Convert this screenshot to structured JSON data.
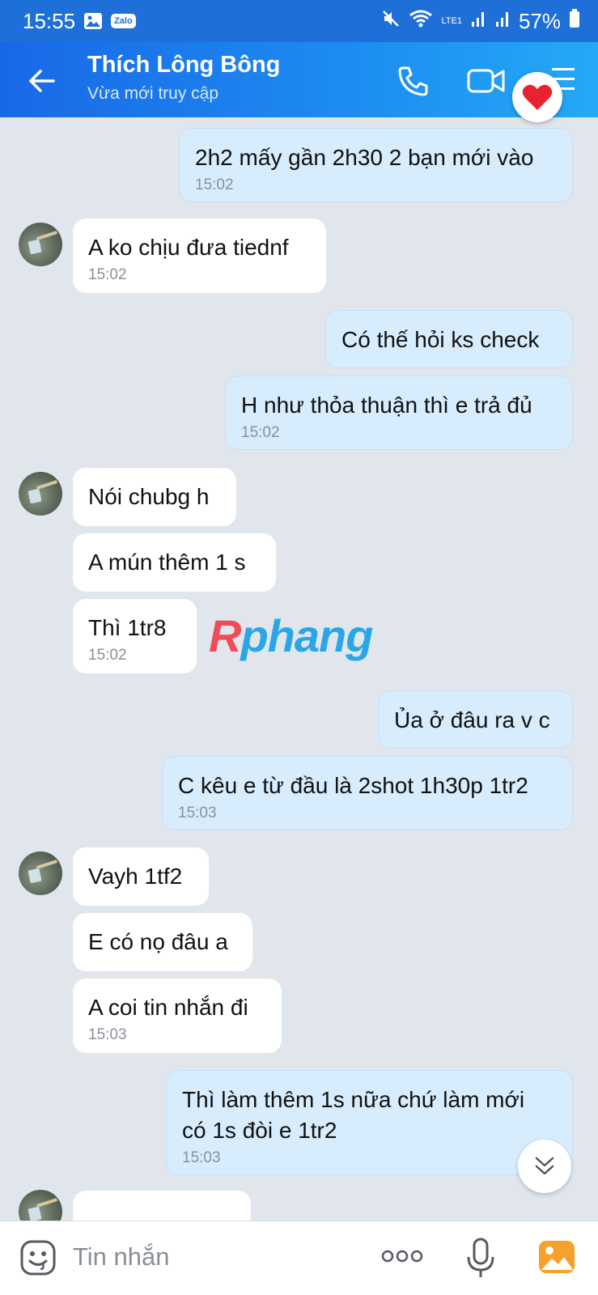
{
  "status_bar": {
    "time": "15:55",
    "battery": "57%",
    "network": "LTE1"
  },
  "header": {
    "title": "Thích Lông Bông",
    "subtitle": "Vừa mới truy cập"
  },
  "messages": [
    {
      "dir": "out",
      "text": "2h2 mấy gần 2h30 2 bạn mới vào",
      "time": "15:02"
    },
    {
      "dir": "in",
      "text": "A ko chịu đưa tiednf",
      "time": "15:02"
    },
    {
      "dir": "out",
      "text": "Có thế hỏi ks check",
      "time": ""
    },
    {
      "dir": "out",
      "text": "H như thỏa thuận thì e trả đủ",
      "time": "15:02"
    },
    {
      "dir": "in",
      "text": "Nói chubg h",
      "time": ""
    },
    {
      "dir": "in",
      "text": "A mún thêm 1 s",
      "time": ""
    },
    {
      "dir": "in",
      "text": "Thì 1tr8",
      "time": "15:02"
    },
    {
      "dir": "out",
      "text": "Ủa ở đâu ra v c",
      "time": ""
    },
    {
      "dir": "out",
      "text": "C kêu e từ đầu là 2shot 1h30p 1tr2",
      "time": "15:03"
    },
    {
      "dir": "in",
      "text": "Vayh 1tf2",
      "time": ""
    },
    {
      "dir": "in",
      "text": "E có nọ đâu a",
      "time": ""
    },
    {
      "dir": "in",
      "text": "A coi tin nhắn đi",
      "time": "15:03"
    },
    {
      "dir": "out",
      "text": "Thì làm thêm 1s nữa chứ làm mới",
      "text2": "có 1s đòi e 1tr2",
      "time": "15:03"
    }
  ],
  "watermark": {
    "part1": "R",
    "part2": "phang"
  },
  "input": {
    "placeholder": "Tin nhắn"
  }
}
